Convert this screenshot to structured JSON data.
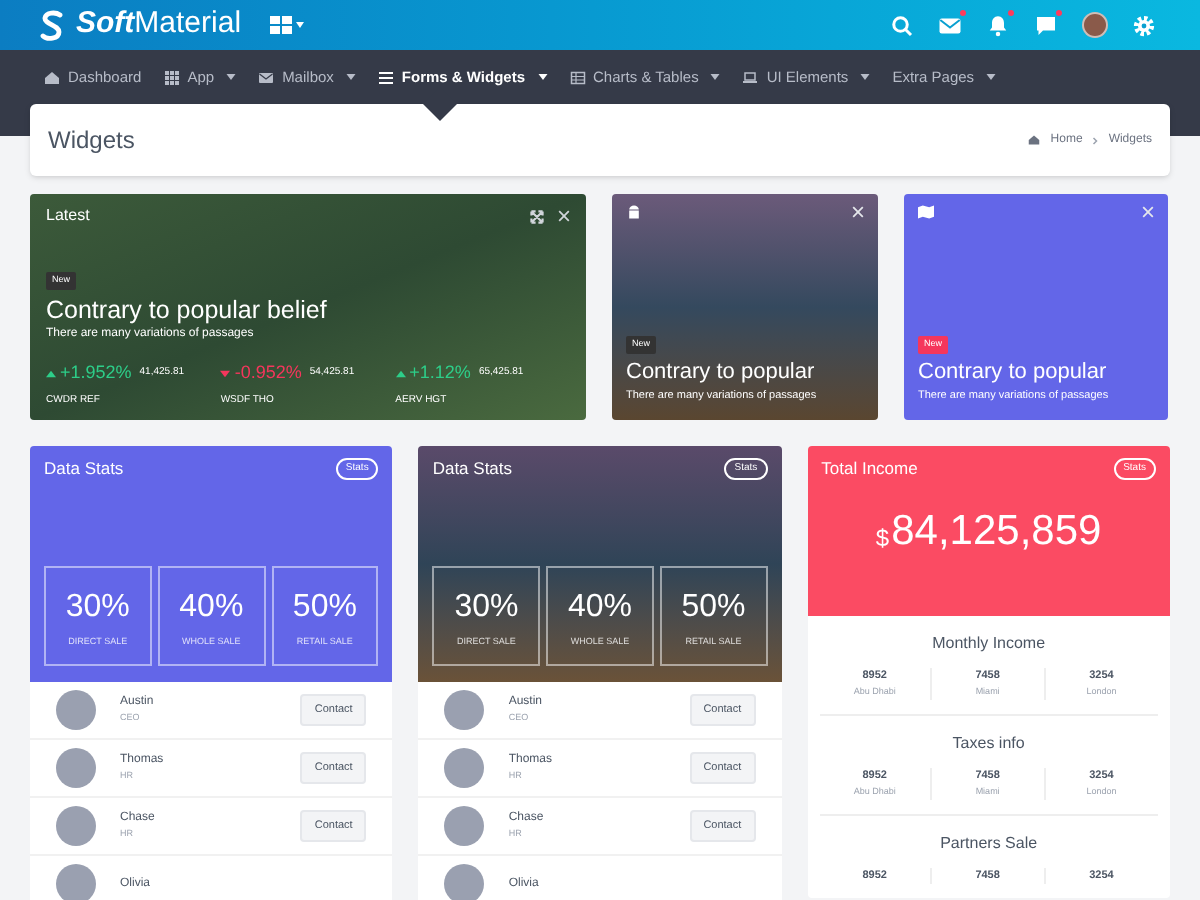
{
  "topbar": {
    "brand": "**Soft**Material",
    "icons": [
      {
        "kind": "search",
        "badge": false
      },
      {
        "kind": "mail",
        "badge": true
      },
      {
        "kind": "bell",
        "badge": true
      },
      {
        "kind": "chat",
        "badge": true
      },
      {
        "kind": "avatar",
        "badge": false
      },
      {
        "kind": "gear",
        "badge": false
      }
    ]
  },
  "nav": [
    {
      "label": "Dashboard",
      "kind": "home",
      "dropdown": false,
      "selected": false
    },
    {
      "label": "App",
      "kind": "grid",
      "dropdown": true,
      "selected": false
    },
    {
      "label": "Mailbox",
      "kind": "mail",
      "dropdown": true,
      "selected": false
    },
    {
      "label": "Forms & Widgets",
      "kind": "list",
      "dropdown": true,
      "selected": true
    },
    {
      "label": "Charts & Tables",
      "kind": "table",
      "dropdown": true,
      "selected": false
    },
    {
      "label": "UI Elements",
      "kind": "laptop",
      "dropdown": true,
      "selected": false
    },
    {
      "label": "Extra Pages",
      "kind": "plain",
      "dropdown": true,
      "selected": false
    }
  ],
  "page_header": {
    "title": "Widgets",
    "breadcrumb": [
      "Home",
      "Widgets"
    ]
  },
  "latest": {
    "title": "Latest",
    "badge": "New",
    "heading": "Contrary to popular belief",
    "subtext": "There are many variations of passages",
    "tickers": [
      {
        "kind": "up",
        "change": "+1.952%",
        "value": "41,425.81",
        "name": "CWDR REF"
      },
      {
        "kind": "down",
        "change": "-0.952%",
        "value": "54,425.81",
        "name": "WSDF THO"
      },
      {
        "kind": "up",
        "change": "+1.12%",
        "value": "65,425.81",
        "name": "AERV HGT"
      }
    ]
  },
  "promo_cards": [
    {
      "kind": "photo",
      "badge": "New",
      "color": "#333333",
      "heading": "Contrary to popular",
      "subtext": "There are many variations of passages"
    },
    {
      "kind": "pattern",
      "badge": "New",
      "color": "#f5365c",
      "heading": "Contrary to popular",
      "subtext": "There are many variations of passages"
    }
  ],
  "stats_cards": [
    {
      "kind": "solid",
      "title": "Data Stats",
      "tag": "Stats",
      "stats": [
        {
          "value": "30%",
          "label": "DIRECT SALE"
        },
        {
          "value": "40%",
          "label": "WHOLE SALE"
        },
        {
          "value": "50%",
          "label": "RETAIL SALE"
        }
      ],
      "people": [
        {
          "name": "Austin",
          "role": "CEO",
          "button": "Contact"
        },
        {
          "name": "Thomas",
          "role": "HR",
          "button": "Contact"
        },
        {
          "name": "Chase",
          "role": "HR",
          "button": "Contact"
        },
        {
          "name": "Olivia"
        }
      ]
    },
    {
      "kind": "photo",
      "title": "Data Stats",
      "tag": "Stats",
      "stats": [
        {
          "value": "30%",
          "label": "DIRECT SALE"
        },
        {
          "value": "40%",
          "label": "WHOLE SALE"
        },
        {
          "value": "50%",
          "label": "RETAIL SALE"
        }
      ],
      "people": [
        {
          "name": "Austin",
          "role": "CEO",
          "button": "Contact"
        },
        {
          "name": "Thomas",
          "role": "HR",
          "button": "Contact"
        },
        {
          "name": "Chase",
          "role": "HR",
          "button": "Contact"
        },
        {
          "name": "Olivia"
        }
      ]
    }
  ],
  "income": {
    "title": "Total Income",
    "tag": "Stats",
    "currency": "$",
    "amount": "84,125,859",
    "sections": [
      {
        "title": "Monthly Income",
        "items": [
          {
            "value": "8952",
            "city": "Abu Dhabi"
          },
          {
            "value": "7458",
            "city": "Miami"
          },
          {
            "value": "3254",
            "city": "London"
          }
        ]
      },
      {
        "title": "Taxes info",
        "items": [
          {
            "value": "8952",
            "city": "Abu Dhabi"
          },
          {
            "value": "7458",
            "city": "Miami"
          },
          {
            "value": "3254",
            "city": "London"
          }
        ]
      },
      {
        "title": "Partners Sale",
        "items": [
          {
            "value": "8952"
          },
          {
            "value": "7458"
          },
          {
            "value": "3254"
          }
        ]
      }
    ]
  }
}
